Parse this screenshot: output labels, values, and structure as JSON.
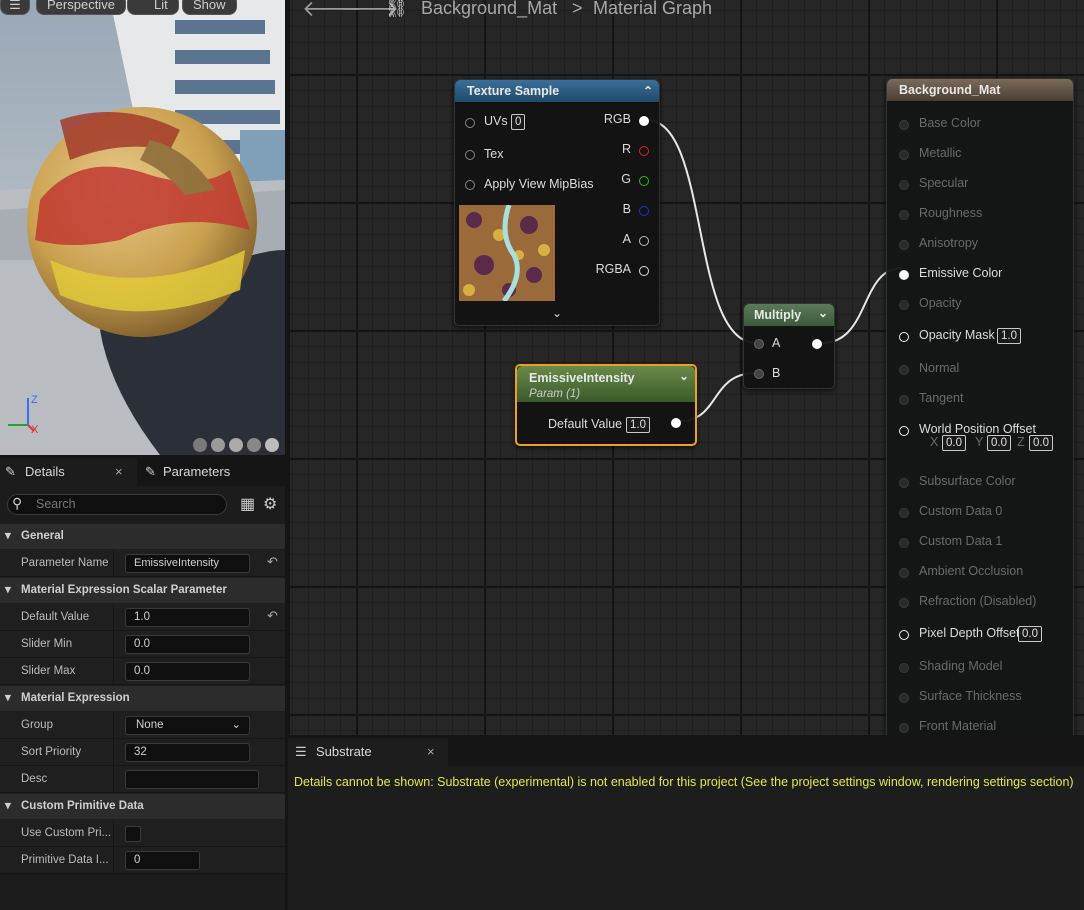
{
  "viewport": {
    "buttons": [
      "Perspective",
      "Lit",
      "Show"
    ],
    "axes": {
      "z": "Z",
      "x": "X"
    }
  },
  "graph": {
    "breadcrumb": {
      "asset": "Background_Mat",
      "sep": ">",
      "graph": "Material Graph"
    },
    "texture_sample": {
      "title": "Texture Sample",
      "inputs": [
        {
          "label": "UVs",
          "value": "0"
        },
        {
          "label": "Tex"
        },
        {
          "label": "Apply View MipBias"
        }
      ],
      "outputs": [
        {
          "label": "RGB",
          "color": "#ffffff"
        },
        {
          "label": "R",
          "color": "#e02020"
        },
        {
          "label": "G",
          "color": "#20c020"
        },
        {
          "label": "B",
          "color": "#2030e0"
        },
        {
          "label": "A",
          "color": "#bbbbbb"
        },
        {
          "label": "RGBA",
          "color": "#dddddd"
        }
      ]
    },
    "multiply": {
      "title": "Multiply",
      "inputs": [
        "A",
        "B"
      ]
    },
    "emissive": {
      "title": "EmissiveIntensity",
      "subtitle": "Param (1)",
      "field_label": "Default Value",
      "field_value": "1.0"
    },
    "result": {
      "title": "Background_Mat",
      "pins": [
        {
          "label": "Base Color",
          "active": false
        },
        {
          "label": "Metallic",
          "active": false
        },
        {
          "label": "Specular",
          "active": false
        },
        {
          "label": "Roughness",
          "active": false
        },
        {
          "label": "Anisotropy",
          "active": false
        },
        {
          "label": "Emissive Color",
          "active": true
        },
        {
          "label": "Opacity",
          "active": false
        },
        {
          "label": "Opacity Mask",
          "active": true,
          "value": "1.0"
        },
        {
          "label": "Normal",
          "active": false
        },
        {
          "label": "Tangent",
          "active": false
        },
        {
          "label": "World Position Offset",
          "active": true
        },
        {
          "label": "Subsurface Color",
          "active": false
        },
        {
          "label": "Custom Data 0",
          "active": false
        },
        {
          "label": "Custom Data 1",
          "active": false
        },
        {
          "label": "Ambient Occlusion",
          "active": false
        },
        {
          "label": "Refraction (Disabled)",
          "active": false
        },
        {
          "label": "Pixel Depth Offset",
          "active": true,
          "value": "0.0"
        },
        {
          "label": "Shading Model",
          "active": false
        },
        {
          "label": "Surface Thickness",
          "active": false
        },
        {
          "label": "Front Material",
          "active": false
        }
      ],
      "wpo": {
        "x_label": "X",
        "x": "0.0",
        "y_label": "Y",
        "y": "0.0",
        "z_label": "Z",
        "z": "0.0"
      }
    }
  },
  "details": {
    "tabs": [
      "Details",
      "Parameters"
    ],
    "close": "×",
    "search_placeholder": "Search",
    "sections": {
      "general": "General",
      "scalar": "Material Expression Scalar Parameter",
      "expr": "Material Expression",
      "custom": "Custom Primitive Data"
    },
    "rows": {
      "param_name": {
        "label": "Parameter Name",
        "value": "EmissiveIntensity"
      },
      "default": {
        "label": "Default Value",
        "value": "1.0"
      },
      "slider_min": {
        "label": "Slider Min",
        "value": "0.0"
      },
      "slider_max": {
        "label": "Slider Max",
        "value": "0.0"
      },
      "group": {
        "label": "Group",
        "value": "None"
      },
      "sort": {
        "label": "Sort Priority",
        "value": "32"
      },
      "desc": {
        "label": "Desc",
        "value": ""
      },
      "use_custom": {
        "label": "Use Custom Pri..."
      },
      "prim_index": {
        "label": "Primitive Data I...",
        "value": "0"
      }
    }
  },
  "substrate": {
    "tab": "Substrate",
    "close": "×",
    "message": "Details cannot be shown: Substrate (experimental) is not enabled for this project (See the project settings window, rendering settings section)"
  }
}
